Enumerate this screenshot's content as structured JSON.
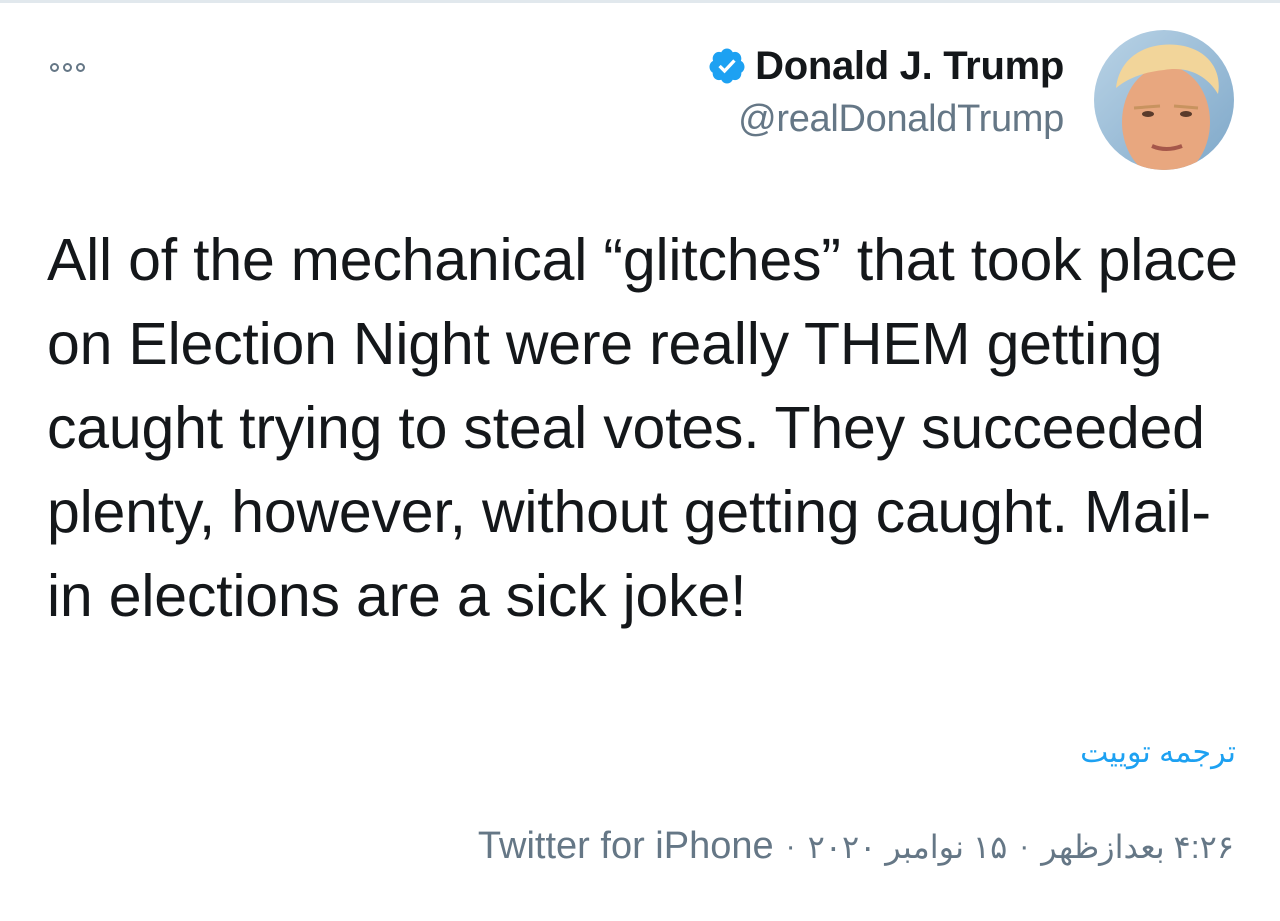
{
  "tweet": {
    "author": {
      "display_name": "Donald J. Trump",
      "handle": "@realDonaldTrump",
      "verified": true
    },
    "text": "All of the mechanical “glitches” that took place on Election Night were really THEM getting caught trying to steal votes. They succeeded plenty, however, without getting caught. Mail-in elections are a sick joke!",
    "translate_label": "ترجمه توییت",
    "time": "۴:۲۶ بعدازظهر",
    "date": "۱۵ نوامبر ۲۰۲۰",
    "separator": "·",
    "source": "Twitter for iPhone"
  },
  "icons": {
    "more": "more-options-icon",
    "verified": "verified-badge-icon"
  },
  "colors": {
    "text": "#14171a",
    "secondary": "#657786",
    "link": "#1da1f2",
    "verified": "#1da1f2"
  }
}
